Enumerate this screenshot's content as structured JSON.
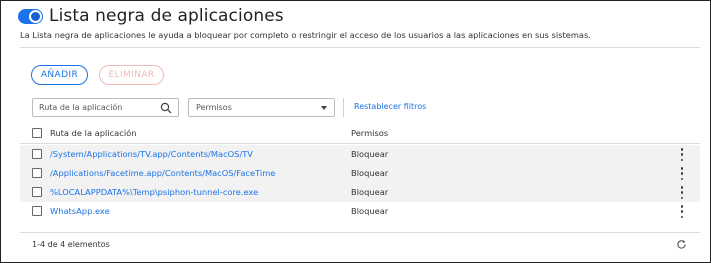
{
  "header": {
    "title": "Lista negra de aplicaciones",
    "toggle_on": true,
    "description": "La Lista negra de aplicaciones le ayuda a bloquear por completo o restringir el acceso de los usuarios a las aplicaciones en sus sistemas."
  },
  "toolbar": {
    "add_label": "AÑADIR",
    "delete_label": "ELIMINAR"
  },
  "filters": {
    "search_placeholder": "Ruta de la aplicación",
    "permissions_placeholder": "Permisos",
    "reset_label": "Restablecer filtros"
  },
  "table": {
    "columns": [
      "Ruta de la aplicación",
      "Permisos"
    ],
    "rows": [
      {
        "path": "/System/Applications/TV.app/Contents/MacOS/TV",
        "permission": "Bloquear"
      },
      {
        "path": "/Applications/Facetime.app/Contents/MacOS/FaceTime",
        "permission": "Bloquear"
      },
      {
        "path": "%LOCALAPPDATA%\\Temp\\psiphon-tunnel-core.exe",
        "permission": "Bloquear"
      },
      {
        "path": "WhatsApp.exe",
        "permission": "Bloquear"
      }
    ]
  },
  "footer": {
    "count_label": "1-4 de 4 elementos"
  },
  "colors": {
    "accent": "#1a73e8",
    "delete_disabled": "#f1b8b8",
    "row_shade": "#f2f2f2"
  },
  "icons": [
    "toggle-switch",
    "search-icon",
    "chevron-down-icon",
    "more-vertical-icon",
    "refresh-icon"
  ]
}
